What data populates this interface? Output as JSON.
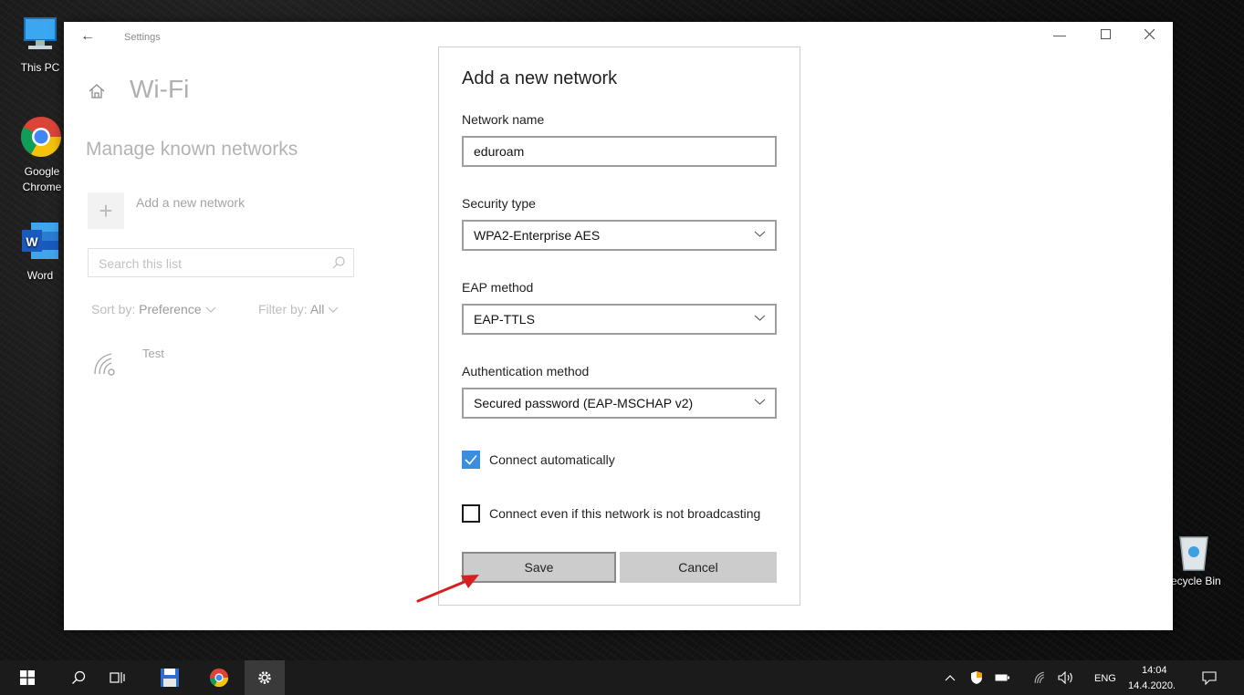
{
  "desktop": {
    "icons": [
      {
        "name": "this-pc",
        "label": "This PC"
      },
      {
        "name": "google-chrome",
        "label": "Google Chrome"
      },
      {
        "name": "word",
        "label": "Word"
      },
      {
        "name": "recycle-bin",
        "label": "ecycle Bin"
      }
    ]
  },
  "settings": {
    "app_title": "Settings",
    "page_title": "Wi-Fi",
    "section_title": "Manage known networks",
    "add_network_label": "Add a new network",
    "search_placeholder": "Search this list",
    "sort_prefix": "Sort by:",
    "sort_value": "Preference",
    "filter_prefix": "Filter by:",
    "filter_value": "All",
    "networks": [
      {
        "name": "Test"
      }
    ]
  },
  "dialog": {
    "title": "Add a new network",
    "network_name_label": "Network name",
    "network_name_value": "eduroam",
    "security_type_label": "Security type",
    "security_type_value": "WPA2-Enterprise AES",
    "eap_method_label": "EAP method",
    "eap_method_value": "EAP-TTLS",
    "auth_method_label": "Authentication method",
    "auth_method_value": "Secured password (EAP-MSCHAP v2)",
    "connect_auto_label": "Connect automatically",
    "connect_auto_checked": true,
    "connect_hidden_label": "Connect even if this network is not broadcasting",
    "connect_hidden_checked": false,
    "save_label": "Save",
    "cancel_label": "Cancel"
  },
  "taskbar": {
    "language": "ENG",
    "time": "14:04",
    "date": "14.4.2020."
  },
  "colors": {
    "accent": "#3b8ede",
    "button": "#cccccc",
    "arrow": "#d62020"
  }
}
